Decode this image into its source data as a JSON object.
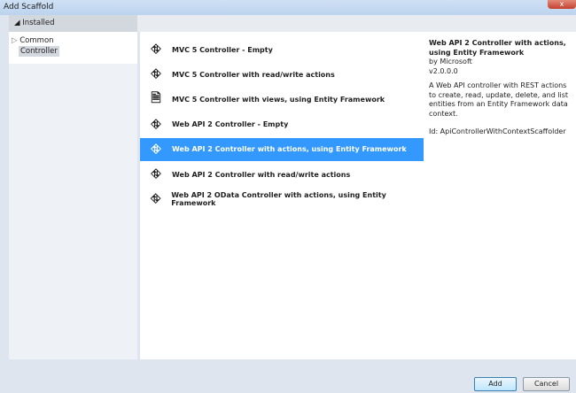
{
  "window": {
    "title": "Add Scaffold",
    "close": "x"
  },
  "tree": {
    "header": "Installed",
    "items": [
      {
        "label": "Common"
      },
      {
        "label": "Controller"
      }
    ]
  },
  "list": {
    "items": [
      {
        "label": "MVC 5 Controller - Empty",
        "icon": "controller-icon"
      },
      {
        "label": "MVC 5 Controller with read/write actions",
        "icon": "controller-icon"
      },
      {
        "label": "MVC 5 Controller with views, using Entity Framework",
        "icon": "document-controller-icon"
      },
      {
        "label": "Web API 2 Controller - Empty",
        "icon": "controller-icon"
      },
      {
        "label": "Web API 2 Controller with actions, using Entity Framework",
        "icon": "controller-icon",
        "selected": true
      },
      {
        "label": "Web API 2 Controller with read/write actions",
        "icon": "controller-icon"
      },
      {
        "label": "Web API 2 OData Controller with actions, using Entity Framework",
        "icon": "controller-icon"
      }
    ]
  },
  "details": {
    "title": "Web API 2 Controller with actions, using Entity Framework",
    "author": "by Microsoft",
    "version": "v2.0.0.0",
    "description": "A Web API controller with REST actions to create, read, update, delete, and list entities from an Entity Framework data context.",
    "id": "Id: ApiControllerWithContextScaffolder"
  },
  "buttons": {
    "add": "Add",
    "cancel": "Cancel"
  },
  "colors": {
    "selection": "#3399ff"
  }
}
